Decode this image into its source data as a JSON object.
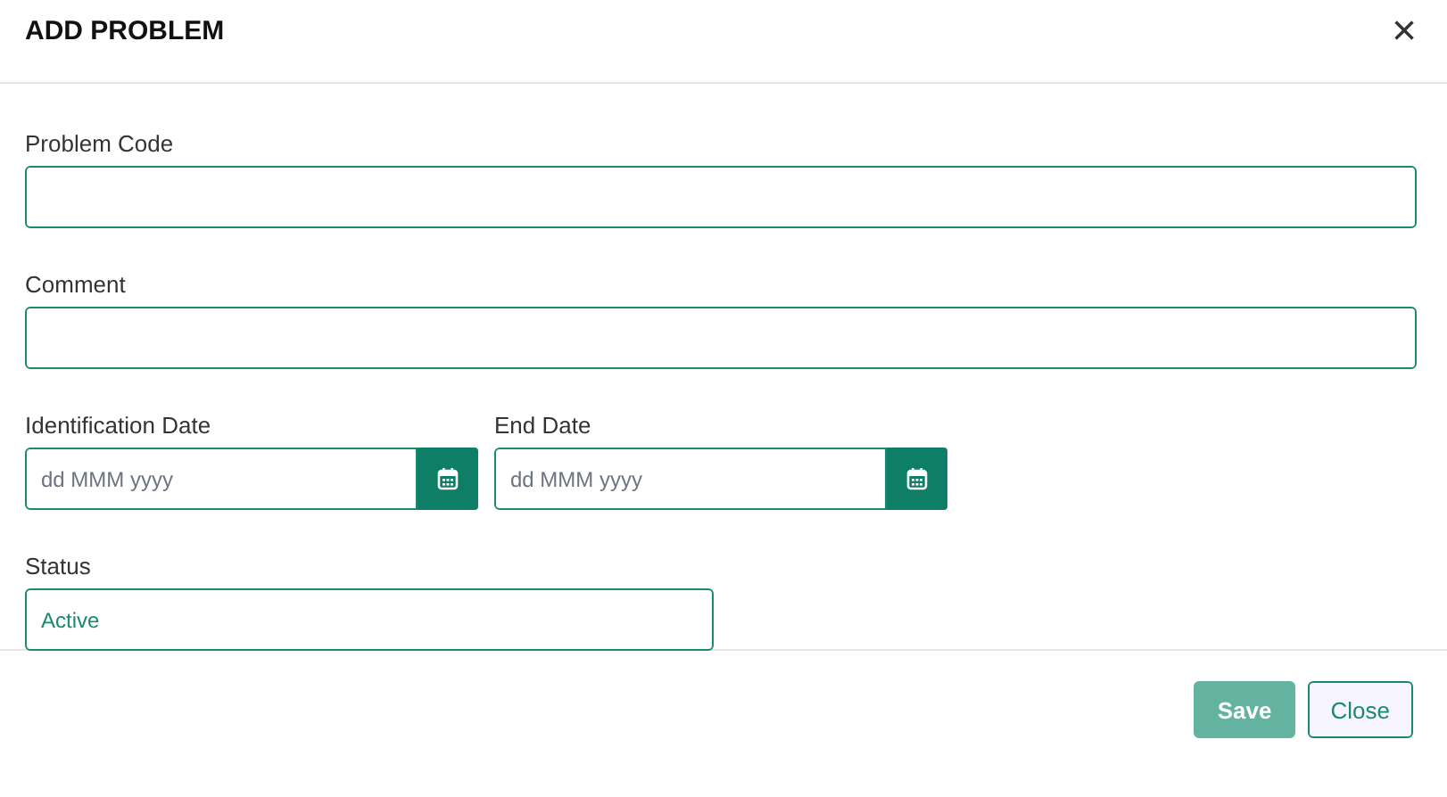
{
  "dialog": {
    "title": "ADD PROBLEM",
    "close_icon": "×"
  },
  "rows": [
    {
      "fields": [
        {
          "kind": "text",
          "label": "Problem Code"
        }
      ]
    },
    {
      "fields": [
        {
          "kind": "text",
          "label": "Comment"
        }
      ]
    },
    {
      "fields": [
        {
          "kind": "date",
          "label": "Identification Date",
          "placeholder": "dd MMM yyyy"
        },
        {
          "kind": "date",
          "label": "End Date",
          "placeholder": "dd MMM yyyy"
        }
      ]
    },
    {
      "fields": [
        {
          "kind": "status",
          "label": "Status",
          "value": "Active"
        }
      ]
    }
  ],
  "buttons": [
    {
      "label": "Save",
      "kind": "primary",
      "disabled": true
    },
    {
      "label": "Close",
      "kind": "secondary",
      "disabled": false
    }
  ]
}
